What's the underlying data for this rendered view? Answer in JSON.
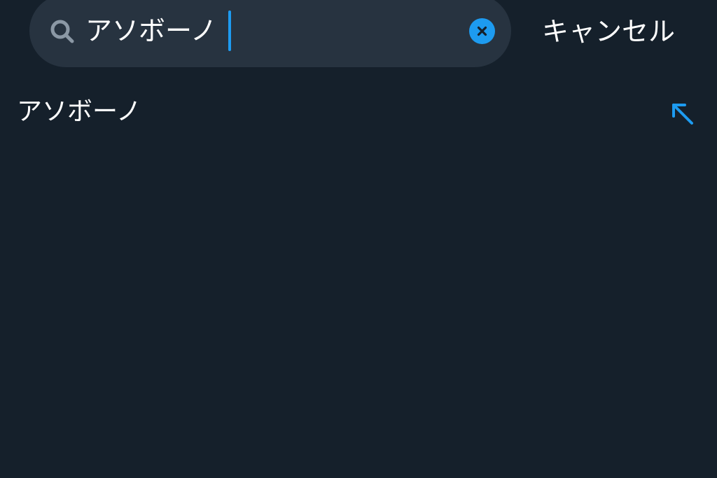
{
  "search": {
    "value": "アソボーノ",
    "search_icon": "search-icon",
    "clear_icon": "close-icon"
  },
  "header": {
    "cancel_label": "キャンセル"
  },
  "suggestions": [
    {
      "label": "アソボーノ",
      "icon": "arrow-up-left-icon"
    }
  ],
  "colors": {
    "background": "#15202b",
    "search_field": "#273340",
    "accent": "#1d9bf0",
    "icon_muted": "#8b98a5",
    "text": "#ffffff"
  }
}
